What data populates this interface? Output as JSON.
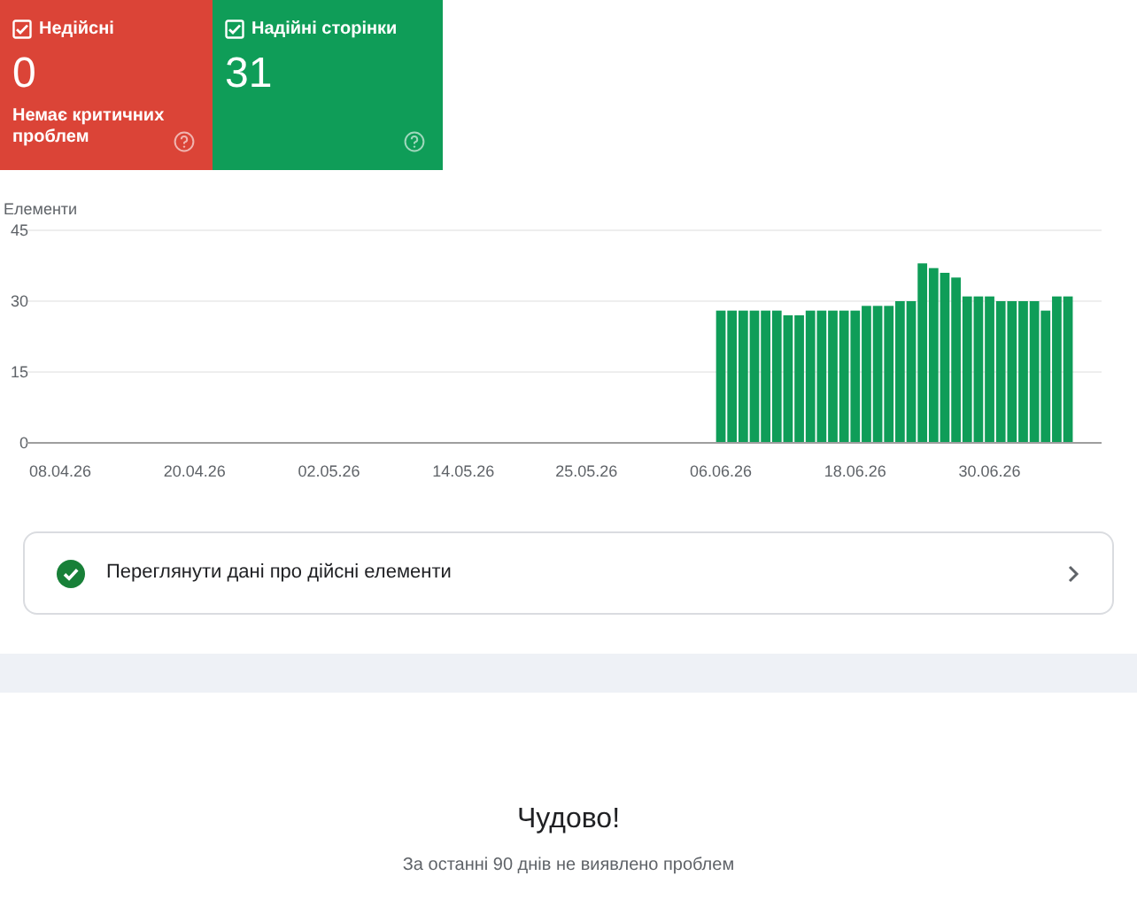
{
  "cards": [
    {
      "label": "Недійсні",
      "checked": true,
      "color": "#db4437",
      "value": "0",
      "note": "Немає критичних проблем"
    },
    {
      "label": "Надійні сторінки",
      "checked": true,
      "color": "#0f9d58",
      "value": "31"
    }
  ],
  "chart_data": {
    "type": "bar",
    "ylabel": "Елементи",
    "categories": [
      "08.04.26",
      null,
      null,
      null,
      null,
      null,
      null,
      null,
      null,
      null,
      null,
      null,
      "20.04.26",
      null,
      null,
      null,
      null,
      null,
      null,
      null,
      null,
      null,
      null,
      null,
      "02.05.26",
      null,
      null,
      null,
      null,
      null,
      null,
      null,
      null,
      null,
      null,
      null,
      "14.05.26",
      null,
      null,
      null,
      null,
      null,
      null,
      null,
      null,
      null,
      null,
      "25.05.26",
      null,
      null,
      null,
      null,
      null,
      null,
      null,
      null,
      null,
      null,
      null,
      "06.06.26",
      null,
      null,
      null,
      null,
      null,
      null,
      null,
      null,
      null,
      null,
      null,
      "18.06.26",
      null,
      null,
      null,
      null,
      null,
      null,
      null,
      null,
      null,
      null,
      null,
      "30.06.26",
      null,
      null,
      null,
      null,
      null,
      null,
      null
    ],
    "values": [
      null,
      null,
      null,
      null,
      null,
      null,
      null,
      null,
      null,
      null,
      null,
      null,
      null,
      null,
      null,
      null,
      null,
      null,
      null,
      null,
      null,
      null,
      null,
      null,
      null,
      null,
      null,
      null,
      null,
      null,
      null,
      null,
      null,
      null,
      null,
      null,
      null,
      null,
      null,
      null,
      null,
      null,
      null,
      null,
      null,
      null,
      null,
      null,
      null,
      null,
      null,
      null,
      null,
      null,
      null,
      null,
      null,
      null,
      null,
      28,
      28,
      28,
      28,
      28,
      28,
      27,
      27,
      28,
      28,
      28,
      28,
      28,
      29,
      29,
      29,
      30,
      30,
      38,
      37,
      36,
      35,
      31,
      31,
      31,
      30,
      30,
      30,
      30,
      28,
      31,
      31
    ],
    "color": "#0f9d58",
    "ylim": [
      0,
      45
    ],
    "yticks": [
      0,
      15,
      30,
      45
    ]
  },
  "link": {
    "label": "Переглянути дані про дійсні елементи"
  },
  "result": {
    "title": "Чудово!",
    "subtitle": "За останні 90 днів не виявлено проблем"
  }
}
